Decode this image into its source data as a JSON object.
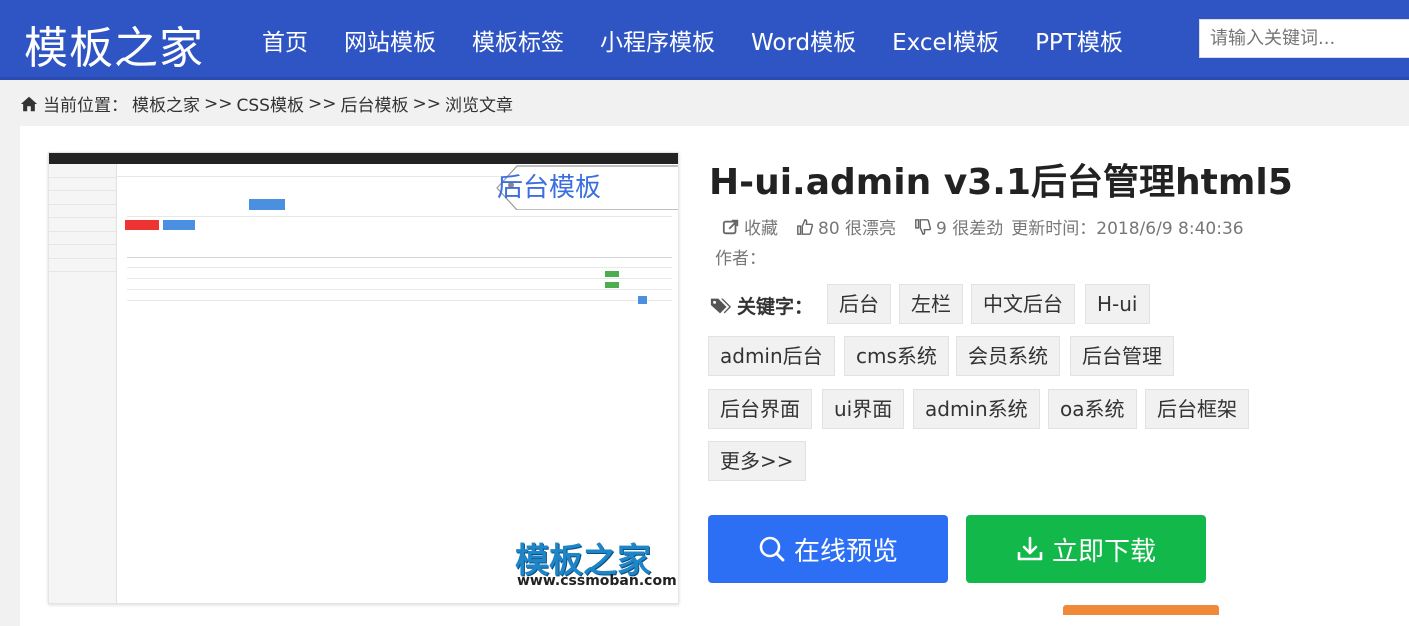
{
  "header": {
    "logo": "模板之家",
    "nav": [
      "首页",
      "网站模板",
      "模板标签",
      "小程序模板",
      "Word模板",
      "Excel模板",
      "PPT模板"
    ],
    "search_placeholder": "请输入关键词..."
  },
  "breadcrumb": {
    "prefix": "当前位置：",
    "items": [
      "模板之家",
      ">>",
      "CSS模板",
      ">>",
      "后台模板",
      ">>",
      "浏览文章"
    ]
  },
  "preview": {
    "tag_label": "后台模板",
    "watermark_logo": "模板之家",
    "watermark_url": "www.cssmoban.com"
  },
  "article": {
    "title": "H-ui.admin v3.1后台管理html5",
    "favorite": "收藏",
    "likes": "80 很漂亮",
    "dislikes": "9 很差劲",
    "updated": "更新时间：2018/6/9 8:40:36",
    "author": "作者：",
    "keyword_label": "关键字：",
    "tags": [
      "后台",
      "左栏",
      "中文后台",
      "H-ui",
      "admin后台",
      "cms系统",
      "会员系统",
      "后台管理",
      "后台界面",
      "ui界面",
      "admin系统",
      "oa系统",
      "后台框架",
      "更多>>"
    ]
  },
  "actions": {
    "preview": "在线预览",
    "download": "立即下载"
  },
  "colors": {
    "header": "#2f55c4",
    "preview_button": "#2c6ff5",
    "download_button": "#13b84a"
  }
}
